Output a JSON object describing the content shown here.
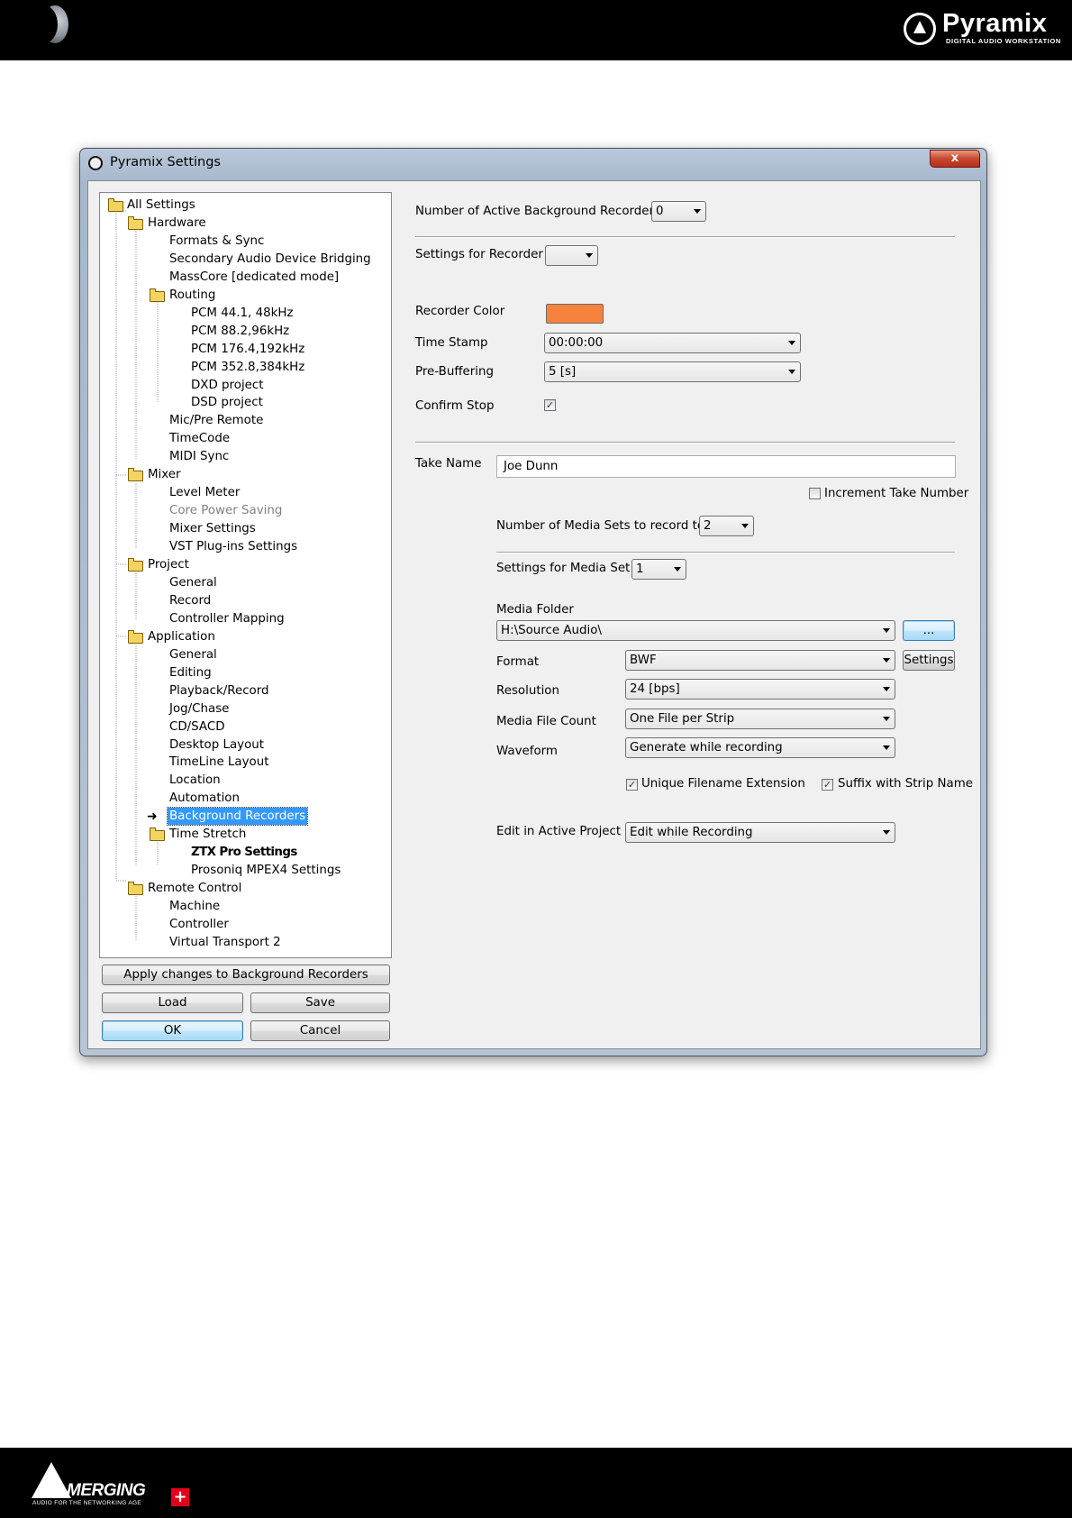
{
  "header": {
    "brand_name": "Pyramix",
    "brand_tagline": "DIGITAL AUDIO WORKSTATION"
  },
  "footer": {
    "brand_name": "MERGING",
    "brand_tagline": "AUDIO FOR THE NETWORKING AGE",
    "plus": "+"
  },
  "window": {
    "title": "Pyramix Settings",
    "close_glyph": "x"
  },
  "tree": {
    "items": [
      "All Settings",
      "Hardware",
      "Formats & Sync",
      "Secondary Audio Device Bridging",
      "MassCore [dedicated mode]",
      "Routing",
      "PCM 44.1, 48kHz",
      "PCM 88.2,96kHz",
      "PCM 176.4,192kHz",
      "PCM 352.8,384kHz",
      "DXD project",
      "DSD project",
      "Mic/Pre Remote",
      "TimeCode",
      "MIDI Sync",
      "Mixer",
      "Level Meter",
      "Core Power Saving",
      "Mixer Settings",
      "VST Plug-ins Settings",
      "Project",
      "General",
      "Record",
      "Controller Mapping",
      "Application",
      "General",
      "Editing",
      "Playback/Record",
      "Jog/Chase",
      "CD/SACD",
      "Desktop Layout",
      "TimeLine Layout",
      "Location",
      "Automation",
      "Background Recorders",
      "Time Stretch",
      "ZTX Pro Settings",
      "Prosoniq MPEX4 Settings",
      "Remote Control",
      "Machine",
      "Controller",
      "Virtual Transport 2"
    ],
    "selected": "Background Recorders"
  },
  "buttons": {
    "apply": "Apply changes to Background Recorders",
    "load": "Load",
    "save": "Save",
    "ok": "OK",
    "cancel": "Cancel",
    "browse": "...",
    "format_settings": "Settings"
  },
  "recorders": {
    "active_label": "Number of Active Background Recorders :",
    "active_value": "0",
    "settings_for_label": "Settings for Recorder #",
    "settings_for_value": "",
    "color_label": "Recorder Color",
    "color_value": "#f7823c",
    "timestamp_label": "Time Stamp",
    "timestamp_value": "00:00:00",
    "prebuffer_label": "Pre-Buffering",
    "prebuffer_value": "5 [s]",
    "confirm_stop_label": "Confirm Stop",
    "confirm_stop_checked": true
  },
  "take": {
    "name_label": "Take Name",
    "name_value": "Joe Dunn",
    "increment_label": "Increment Take Number",
    "increment_checked": false
  },
  "media": {
    "sets_label": "Number of Media Sets to record to :",
    "sets_value": "2",
    "settings_for_label": "Settings for Media Set #",
    "settings_for_value": "1",
    "folder_label": "Media Folder",
    "folder_value": "H:\\Source Audio\\",
    "format_label": "Format",
    "format_value": "BWF",
    "resolution_label": "Resolution",
    "resolution_value": "24 [bps]",
    "file_count_label": "Media File Count",
    "file_count_value": "One File per Strip",
    "waveform_label": "Waveform",
    "waveform_value": "Generate while recording",
    "unique_ext_label": "Unique Filename Extension",
    "unique_ext_checked": true,
    "suffix_label": "Suffix with Strip Name",
    "suffix_checked": true,
    "edit_label": "Edit in Active Project",
    "edit_value": "Edit while Recording"
  },
  "icons": [
    "moon-icon",
    "pyramix-logo-icon",
    "merging-logo-icon",
    "window-app-icon",
    "close-icon",
    "folder-icon",
    "arrow-right-icon",
    "chevron-down-icon",
    "checkmark-icon"
  ]
}
